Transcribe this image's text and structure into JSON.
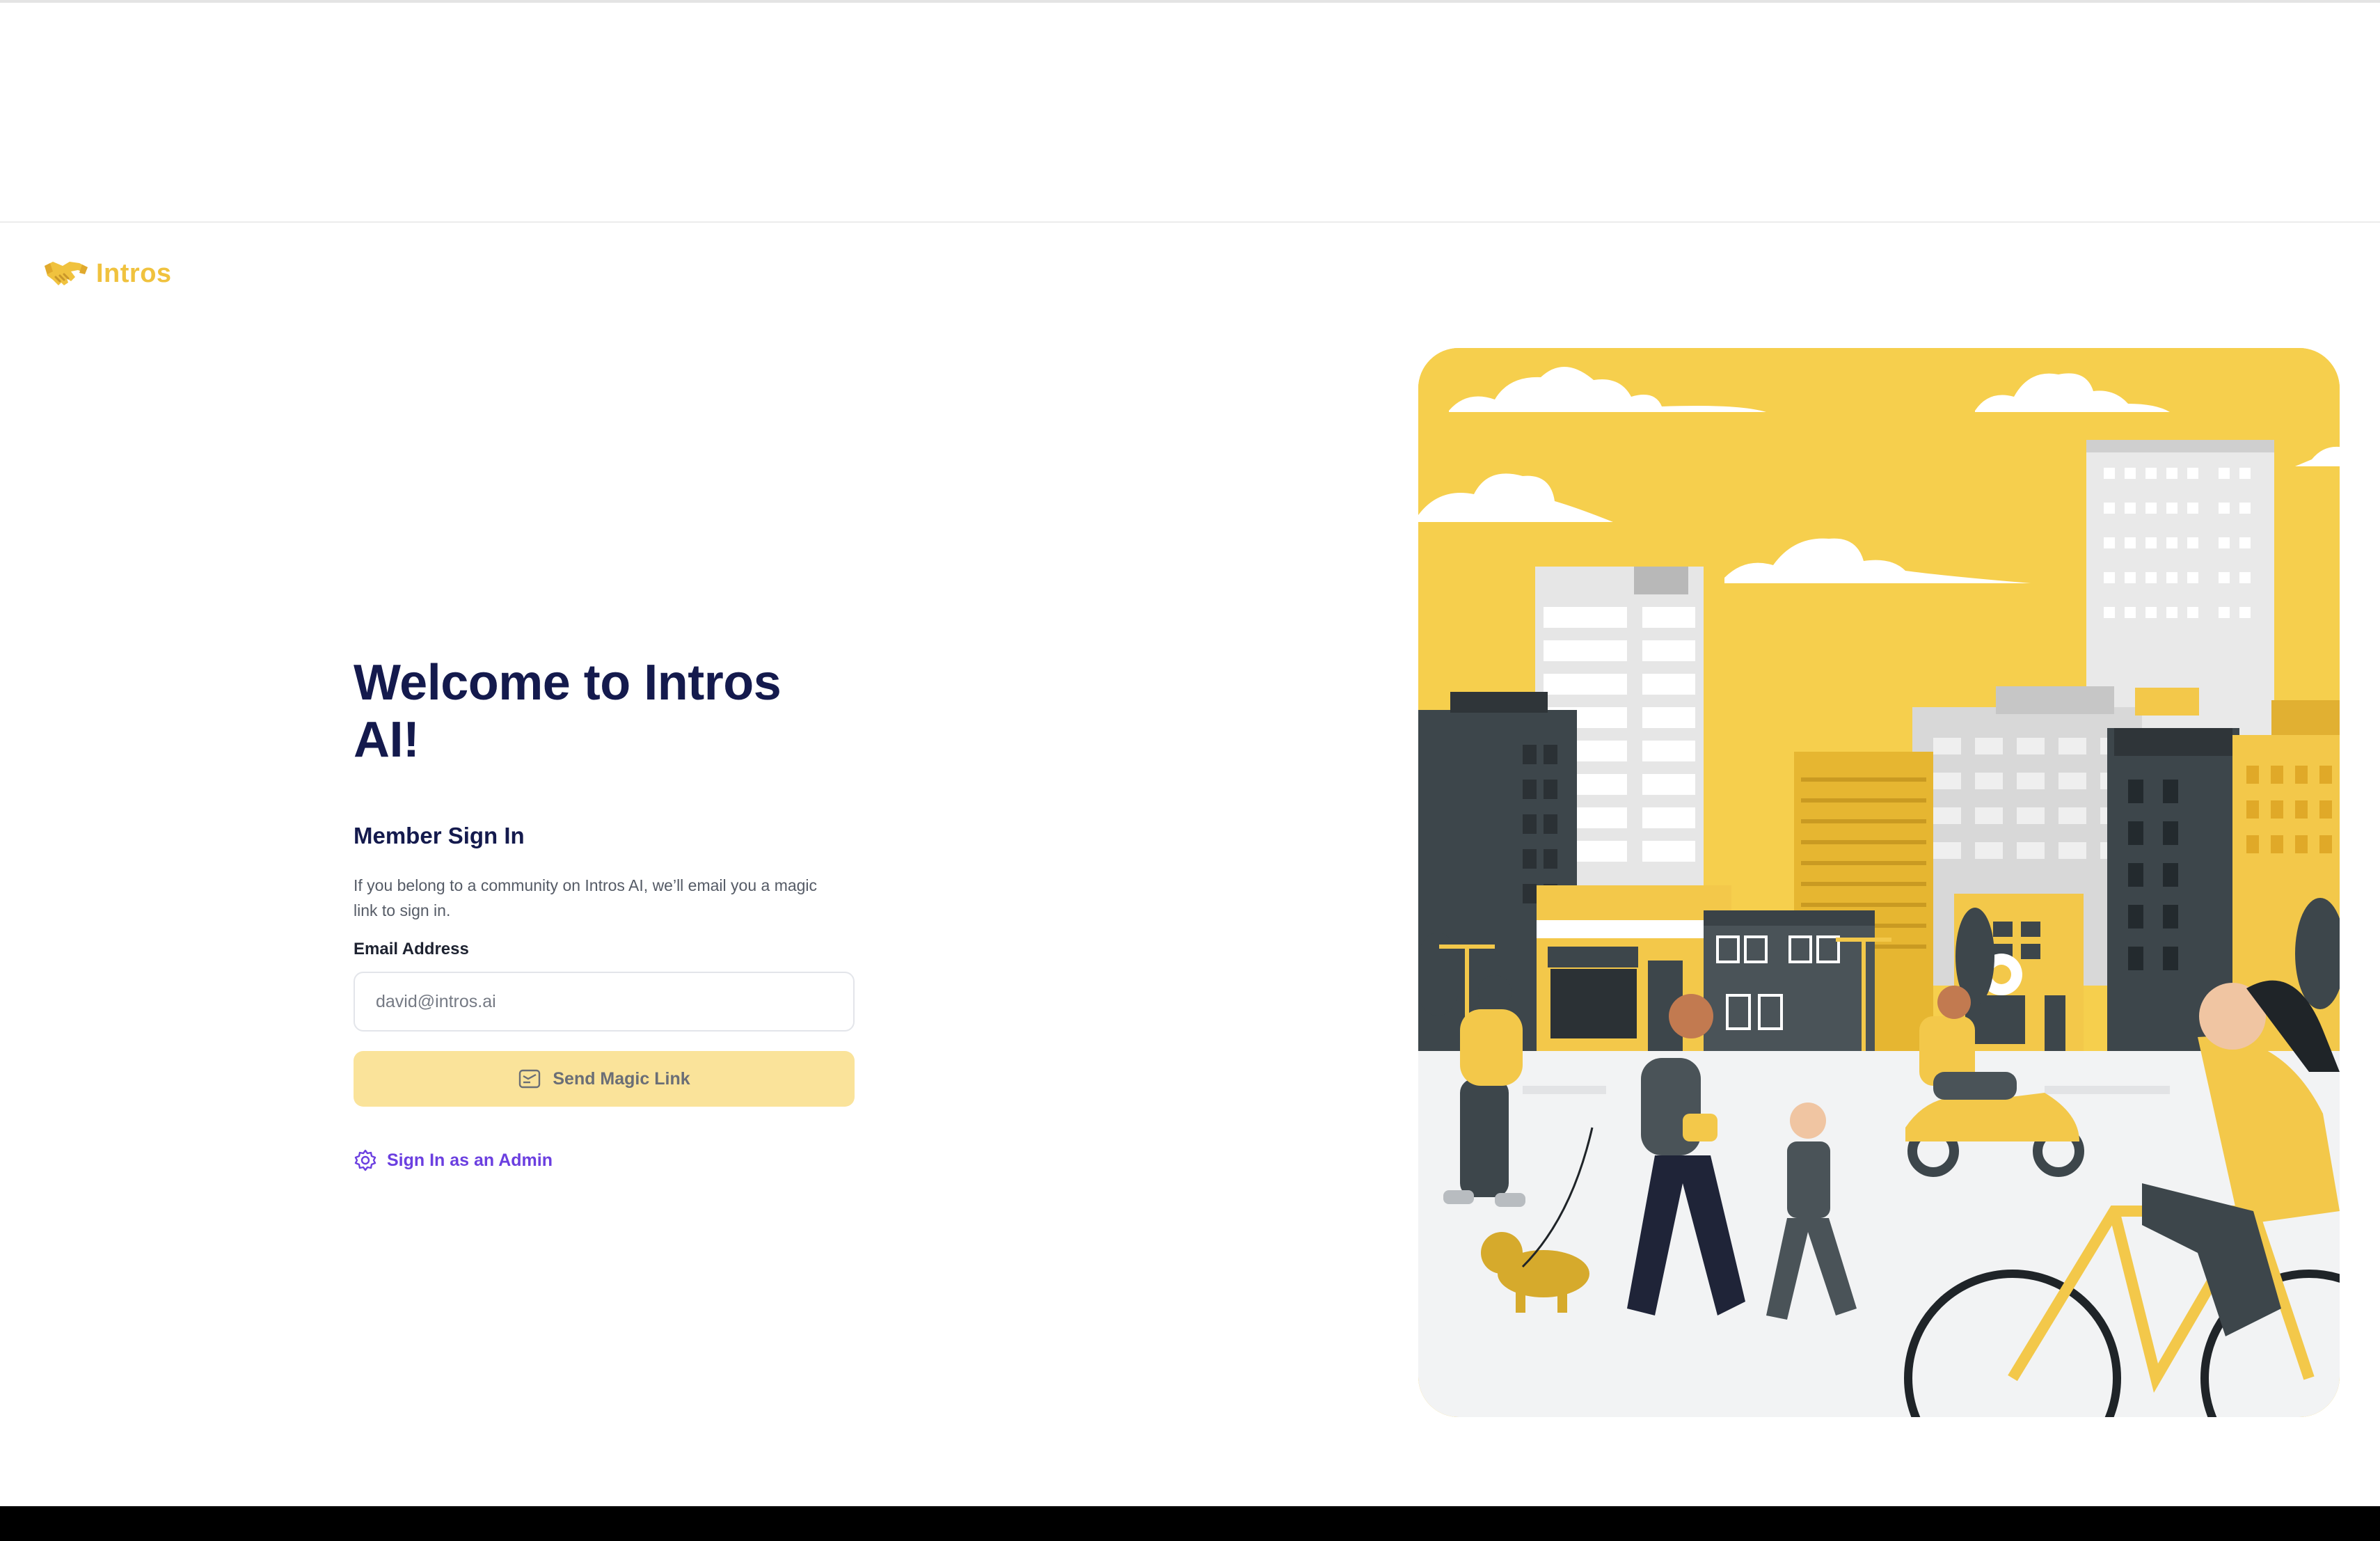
{
  "brand": {
    "name": "Intros",
    "logo_icon": "handshake-icon",
    "color": "#f0c23e"
  },
  "main": {
    "welcome": "Welcome to Intros AI!",
    "member_title": "Member Sign In",
    "description": "If you belong to a community on Intros AI, we’ll email you a magic link to sign in.",
    "email_label": "Email Address",
    "email_placeholder": "david@intros.ai",
    "send_button_label": "Send Magic Link",
    "send_button_icon": "mail-icon",
    "admin_link_label": "Sign In as an Admin",
    "admin_link_icon": "gear-icon"
  },
  "colors": {
    "heading": "#141a4d",
    "button_bg": "#fae39a",
    "link": "#6b3fe0",
    "illustration_sky": "#f6cf4d"
  }
}
